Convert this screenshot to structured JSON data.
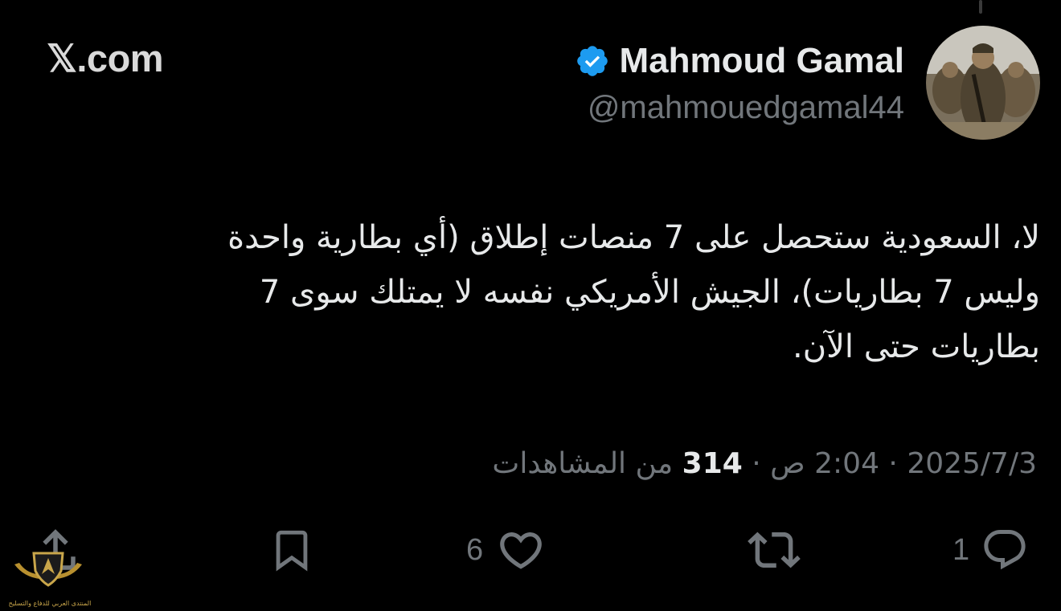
{
  "brand": {
    "site": "𝕏.com"
  },
  "author": {
    "display_name": "Mahmoud Gamal",
    "handle": "@mahmouedgamal44",
    "verified_icon": "verified-badge-icon",
    "avatar": "avatar-photo"
  },
  "tweet": {
    "lines": [
      "لا، السعودية ستحصل على 7 منصات إطلاق (أي بطارية واحدة",
      "وليس 7 بطاريات)، الجيش الأمريكي نفسه لا يمتلك سوى 7",
      "بطاريات حتى الآن."
    ]
  },
  "meta": {
    "date": "2025/7/3",
    "time": "2:04 ص",
    "separator": " · ",
    "views_count": "314",
    "views_label": "من المشاهدات"
  },
  "actions": {
    "reply_count": "1",
    "retweet_icon": "retweet-icon",
    "like_count": "6",
    "bookmark_icon": "bookmark-icon",
    "share_icon": "share-icon"
  },
  "watermark": {
    "text": "المنتدى العربي للدفاع والتسليح"
  },
  "colors": {
    "background": "#000000",
    "primary_text": "#e7e9ea",
    "secondary_text": "#71767b",
    "verified": "#1d9bf0"
  }
}
